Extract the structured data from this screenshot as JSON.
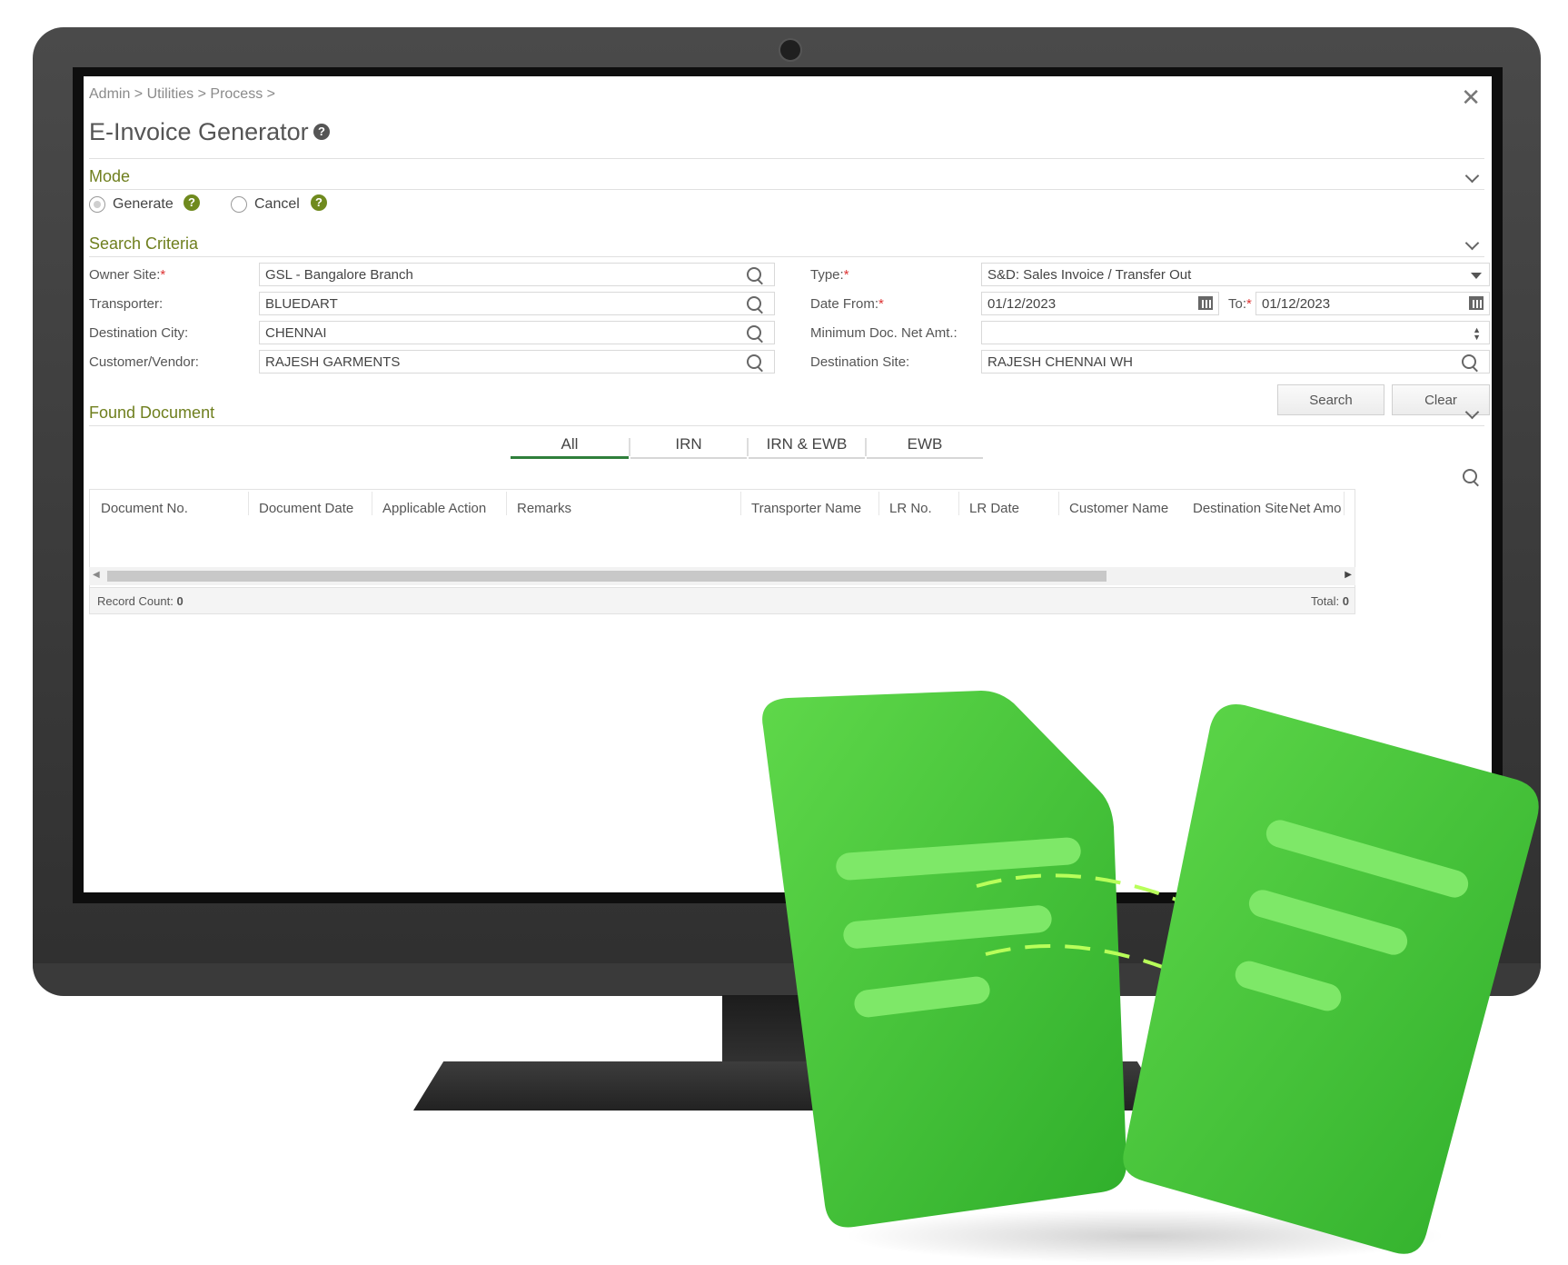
{
  "breadcrumb": [
    "Admin",
    "Utilities",
    "Process"
  ],
  "page": {
    "title": "E-Invoice Generator"
  },
  "mode": {
    "title": "Mode",
    "options": [
      {
        "label": "Generate",
        "selected": true
      },
      {
        "label": "Cancel",
        "selected": false
      }
    ]
  },
  "search_criteria": {
    "title": "Search Criteria",
    "owner_site": {
      "label": "Owner Site:",
      "value": "GSL - Bangalore Branch",
      "required": true
    },
    "transporter": {
      "label": "Transporter:",
      "value": "BLUEDART"
    },
    "destination_city": {
      "label": "Destination City:",
      "value": "CHENNAI"
    },
    "customer_vendor": {
      "label": "Customer/Vendor:",
      "value": "RAJESH GARMENTS"
    },
    "type": {
      "label": "Type:",
      "value": "S&D: Sales Invoice / Transfer Out",
      "required": true
    },
    "date_from": {
      "label": "Date From:",
      "value": "01/12/2023",
      "required": true
    },
    "date_to": {
      "label": "To:",
      "value": "01/12/2023",
      "required": true
    },
    "min_doc_net_amt": {
      "label": "Minimum Doc. Net Amt.:",
      "value": ""
    },
    "destination_site": {
      "label": "Destination Site:",
      "value": "RAJESH CHENNAI WH"
    },
    "search_button": "Search",
    "clear_button": "Clear"
  },
  "found_document": {
    "title": "Found Document",
    "tabs": [
      {
        "label": "All",
        "active": true
      },
      {
        "label": "IRN",
        "active": false
      },
      {
        "label": "IRN & EWB",
        "active": false
      },
      {
        "label": "EWB",
        "active": false
      }
    ],
    "columns": [
      "Document No.",
      "Document Date",
      "Applicable Action",
      "Remarks",
      "Transporter Name",
      "LR No.",
      "LR Date",
      "Customer Name",
      "Destination Site",
      "Net Amo"
    ],
    "rows": [],
    "record_count_label": "Record Count:",
    "record_count": "0",
    "total_label": "Total:",
    "total": "0"
  },
  "colors": {
    "section_title": "#6f7f1e",
    "help_icon": "#6f8a1e",
    "active_tab": "#2f7f3b",
    "illustration_green": "#3fbf3a"
  }
}
